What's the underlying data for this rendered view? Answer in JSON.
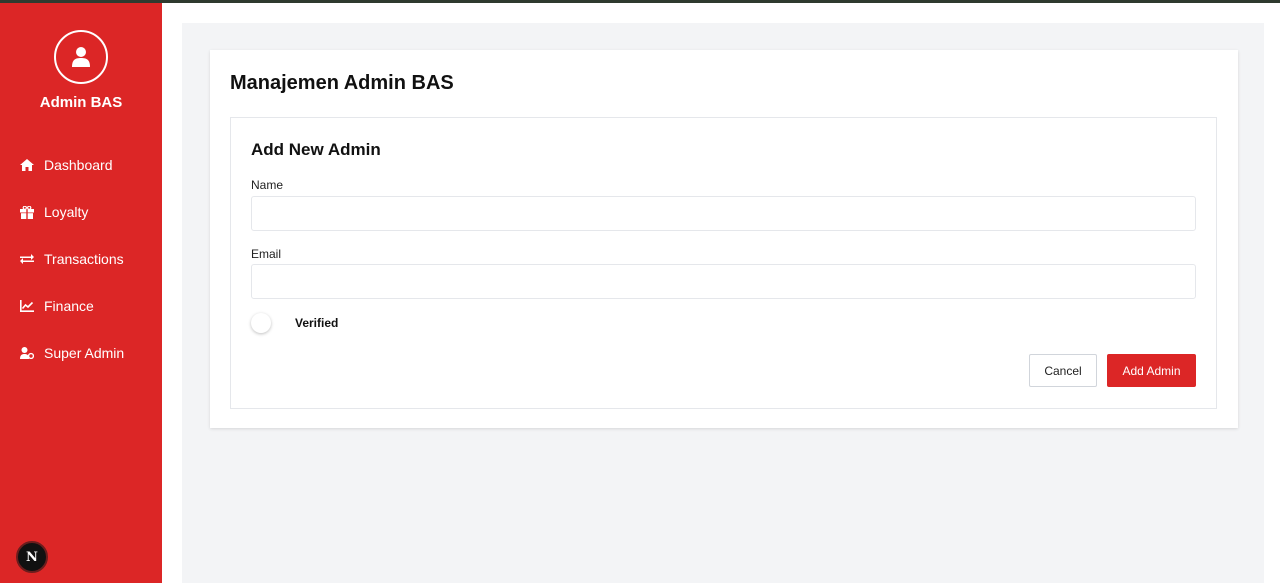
{
  "sidebar": {
    "brand": "Admin BAS",
    "items": [
      {
        "label": "Dashboard",
        "icon": "home-icon"
      },
      {
        "label": "Loyalty",
        "icon": "gift-icon"
      },
      {
        "label": "Transactions",
        "icon": "exchange-icon"
      },
      {
        "label": "Finance",
        "icon": "chart-line-icon"
      },
      {
        "label": "Super Admin",
        "icon": "user-cog-icon"
      }
    ],
    "badge": "N"
  },
  "main": {
    "title": "Manajemen Admin BAS",
    "form": {
      "title": "Add New Admin",
      "name_label": "Name",
      "name_value": "",
      "email_label": "Email",
      "email_value": "",
      "verified_label": "Verified",
      "cancel_label": "Cancel",
      "submit_label": "Add Admin"
    }
  },
  "colors": {
    "accent": "#dc2626",
    "background": "#f3f4f6"
  }
}
